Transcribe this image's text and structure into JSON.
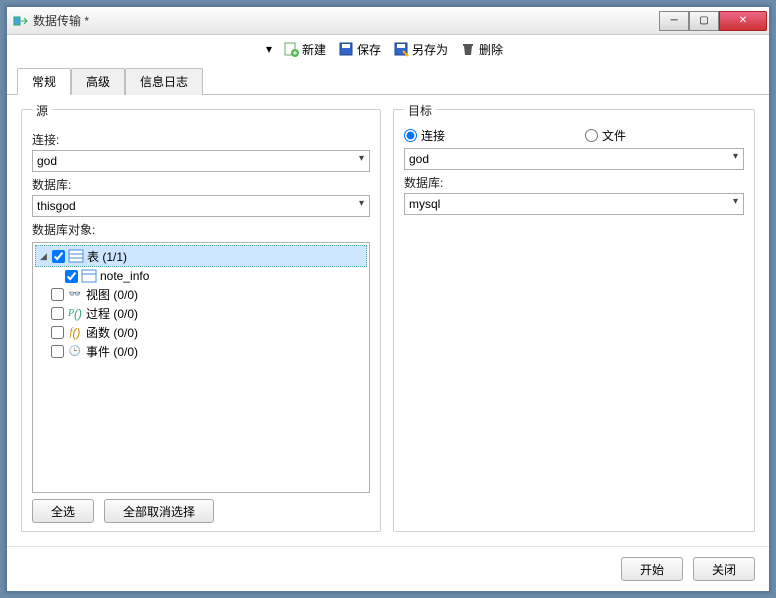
{
  "window": {
    "title": "数据传输 *"
  },
  "toolbar": {
    "new": "新建",
    "save": "保存",
    "saveas": "另存为",
    "delete": "删除"
  },
  "tabs": {
    "general": "常规",
    "advanced": "高级",
    "log": "信息日志"
  },
  "source": {
    "title": "源",
    "conn_label": "连接:",
    "conn_value": "god",
    "db_label": "数据库:",
    "db_value": "thisgod",
    "objects_label": "数据库对象:",
    "tree": {
      "tables": "表  (1/1)",
      "note_info": "note_info",
      "views": "视图  (0/0)",
      "procs": "过程  (0/0)",
      "funcs": "函数  (0/0)",
      "events": "事件  (0/0)"
    },
    "select_all": "全选",
    "deselect_all": "全部取消选择"
  },
  "target": {
    "title": "目标",
    "radio_conn": "连接",
    "radio_file": "文件",
    "conn_value": "god",
    "db_label": "数据库:",
    "db_value": "mysql"
  },
  "footer": {
    "start": "开始",
    "close": "关闭"
  }
}
